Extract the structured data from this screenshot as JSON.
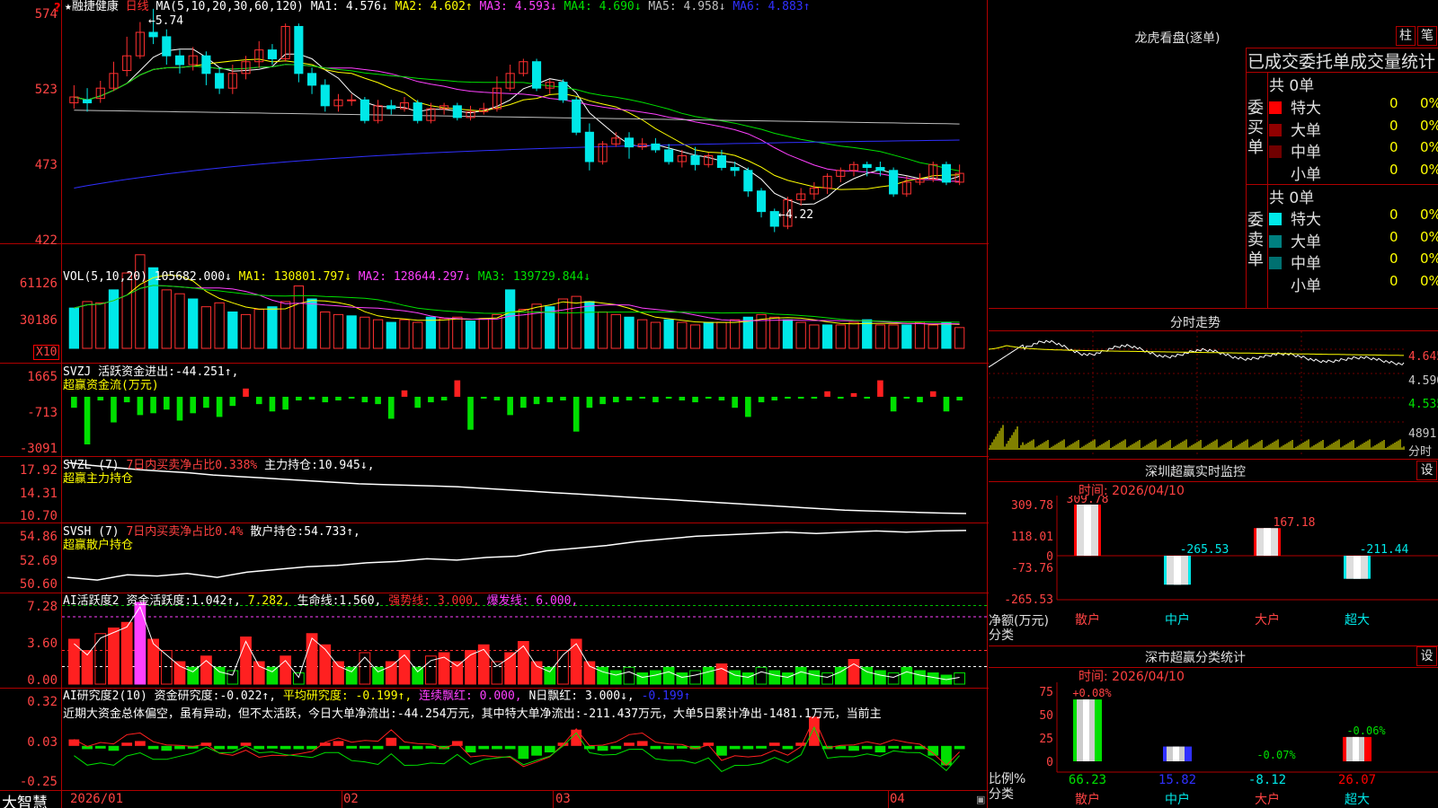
{
  "chart_title": {
    "star": "★",
    "stock": "融捷健康",
    "period": "日线"
  },
  "main": {
    "ma_label": "MA(5,10,20,30,60,120)",
    "ma": [
      {
        "name": "MA1:",
        "value": "4.576↓",
        "color": "#ffffff"
      },
      {
        "name": "MA2:",
        "value": "4.602↑",
        "color": "#ffff00"
      },
      {
        "name": "MA3:",
        "value": "4.593↓",
        "color": "#ff40ff"
      },
      {
        "name": "MA4:",
        "value": "4.690↓",
        "color": "#00e000"
      },
      {
        "name": "MA5:",
        "value": "4.958↓",
        "color": "#c0c0c0"
      },
      {
        "name": "MA6:",
        "value": "4.883↑",
        "color": "#3030ff"
      }
    ],
    "yaxis": [
      "574",
      "523",
      "473",
      "422"
    ],
    "high_note": "5.74",
    "low_note": "4.22"
  },
  "vol": {
    "label": "VOL(5,10,20)",
    "value": "105682.000↓",
    "ma": [
      {
        "name": "MA1:",
        "value": "130801.797↓",
        "color": "#ffff00"
      },
      {
        "name": "MA2:",
        "value": "128644.297↓",
        "color": "#ff40ff"
      },
      {
        "name": "MA3:",
        "value": "139729.844↓",
        "color": "#00e000"
      }
    ],
    "yaxis": [
      "61126",
      "30186"
    ],
    "unit": "X10"
  },
  "svzj": {
    "label": "SVZJ",
    "name": "活跃资金进出:",
    "value": "-44.251↑,",
    "sub": "超赢资金流(万元)",
    "yaxis": [
      "1665",
      "-713",
      "-3091"
    ]
  },
  "svzl": {
    "label": "SVZL (7)",
    "ratio": "7日内买卖净占比0.338%",
    "name": "主力持仓:",
    "value": "10.945↓,",
    "sub": "超赢主力持仓",
    "yaxis": [
      "17.92",
      "14.31",
      "10.70"
    ]
  },
  "svsh": {
    "label": "SVSH (7)",
    "ratio": "7日内买卖净占比0.4%",
    "name": "散户持仓:",
    "value": "54.733↑,",
    "sub": "超赢散户持仓",
    "yaxis": [
      "54.86",
      "52.69",
      "50.60"
    ]
  },
  "ai_active": {
    "label": "AI活跃度2",
    "name": "资金活跃度:",
    "value": "1.042↑,",
    "v2": "7.282,",
    "life_name": "生命线:",
    "life": "1.560,",
    "strong": "强势线: 3.000,",
    "burst": "爆发线: 6.000,",
    "yaxis": [
      "7.28",
      "3.60",
      "0.00"
    ]
  },
  "ai_research": {
    "label": "AI研究度2(10)",
    "name": "资金研究度:",
    "value": "-0.022↑,",
    "avg": "平均研究度: -0.199↑,",
    "red_n": "连续飘红: 0.000,",
    "n_red": "N日飘红: 3.000↓,",
    "last": "-0.199↑",
    "comment": "近期大资金总体偏空，虽有异动，但不太活跃，今日大单净流出:-44.254万元，其中特大单净流出:-211.437万元，大单5日累计净出-1481.1万元，当前主",
    "yaxis": [
      "0.32",
      "0.03",
      "-0.25"
    ]
  },
  "xaxis": [
    "2026/01",
    "02",
    "03",
    "04"
  ],
  "footer": {
    "brand": "大智慧"
  },
  "dragon": {
    "title": "龙虎看盘(逐单)",
    "btn_bar": "柱",
    "btn_pen": "笔",
    "header": "已成交委托单成交量统计",
    "buy_label": "委买单",
    "sell_label": "委卖单",
    "buy_total": "共 0单",
    "sell_total": "共 0单",
    "buy_rows": [
      {
        "name": "特大",
        "count": "0",
        "pct": "0%",
        "color": "#ff0000"
      },
      {
        "name": "大单",
        "count": "0",
        "pct": "0%",
        "color": "#900000"
      },
      {
        "name": "中单",
        "count": "0",
        "pct": "0%",
        "color": "#700000"
      },
      {
        "name": "小单",
        "count": "0",
        "pct": "0%",
        "color": "#000000"
      }
    ],
    "sell_rows": [
      {
        "name": "特大",
        "count": "0",
        "pct": "0%",
        "color": "#00e8e8"
      },
      {
        "name": "大单",
        "count": "0",
        "pct": "0%",
        "color": "#008080"
      },
      {
        "name": "中单",
        "count": "0",
        "pct": "0%",
        "color": "#007070"
      },
      {
        "name": "小单",
        "count": "0",
        "pct": "0%",
        "color": "#000000"
      }
    ]
  },
  "intraday": {
    "title": "分时走势",
    "prices": [
      "4.645",
      "4.590",
      "4.535"
    ],
    "vol": "4891",
    "vol_unit": "分时"
  },
  "monitor": {
    "title": "深圳超赢实时监控",
    "btn": "设",
    "date": "时间: 2026/04/10",
    "yaxis": [
      "309.78",
      "118.01",
      "0",
      "-73.76",
      "-265.53"
    ],
    "ylabel": "净额(万元)",
    "xlabel": "分类",
    "categories": [
      "散户",
      "中户",
      "大户",
      "超大"
    ],
    "bar_labels": [
      "309.78",
      "-265.53",
      "167.18",
      "-211.44"
    ]
  },
  "classify": {
    "title": "深市超赢分类统计",
    "btn": "设",
    "date": "时间: 2026/04/10",
    "yaxis": [
      "75",
      "50",
      "25",
      "0"
    ],
    "ylabel": "比例%",
    "xlabel": "分类",
    "categories": [
      "散户",
      "中户",
      "大户",
      "超大"
    ],
    "top_labels": [
      "+0.08%",
      "",
      "-0.07%",
      "-0.06%"
    ],
    "bottom_values": [
      "66.23",
      "15.82",
      "-8.12",
      "26.07"
    ]
  },
  "chart_data": [
    {
      "type": "candlestick",
      "title": "融捷健康 日线",
      "ylim": [
        4.15,
        5.8
      ],
      "x": [
        "2026/01",
        "02",
        "03",
        "04"
      ],
      "ohlc": [
        [
          5.1,
          5.14,
          5.22,
          5.06
        ],
        [
          5.12,
          5.1,
          5.2,
          5.04
        ],
        [
          5.13,
          5.2,
          5.25,
          5.1
        ],
        [
          5.2,
          5.3,
          5.38,
          5.18
        ],
        [
          5.32,
          5.42,
          5.55,
          5.28
        ],
        [
          5.42,
          5.58,
          5.65,
          5.4
        ],
        [
          5.58,
          5.55,
          5.74,
          5.5
        ],
        [
          5.55,
          5.42,
          5.6,
          5.36
        ],
        [
          5.42,
          5.36,
          5.46,
          5.3
        ],
        [
          5.36,
          5.42,
          5.48,
          5.32
        ],
        [
          5.42,
          5.3,
          5.45,
          5.22
        ],
        [
          5.3,
          5.2,
          5.34,
          5.16
        ],
        [
          5.2,
          5.3,
          5.36,
          5.16
        ],
        [
          5.3,
          5.38,
          5.42,
          5.26
        ],
        [
          5.38,
          5.46,
          5.52,
          5.34
        ],
        [
          5.46,
          5.4,
          5.5,
          5.36
        ],
        [
          5.4,
          5.62,
          5.64,
          5.38
        ],
        [
          5.62,
          5.3,
          5.64,
          5.24
        ],
        [
          5.3,
          5.22,
          5.34,
          5.16
        ],
        [
          5.22,
          5.08,
          5.26,
          5.04
        ],
        [
          5.08,
          5.12,
          5.16,
          5.04
        ],
        [
          5.12,
          5.12,
          5.16,
          5.08
        ],
        [
          5.12,
          4.98,
          5.14,
          4.96
        ],
        [
          4.98,
          5.08,
          5.12,
          4.96
        ],
        [
          5.08,
          5.06,
          5.12,
          5.02
        ],
        [
          5.06,
          5.1,
          5.14,
          5.04
        ],
        [
          5.1,
          4.98,
          5.12,
          4.96
        ],
        [
          4.98,
          5.06,
          5.1,
          4.96
        ],
        [
          5.06,
          5.08,
          5.1,
          5.02
        ],
        [
          5.08,
          5.0,
          5.1,
          4.98
        ],
        [
          5.0,
          5.04,
          5.08,
          4.98
        ],
        [
          5.04,
          5.06,
          5.1,
          5.02
        ],
        [
          5.06,
          5.2,
          5.28,
          5.04
        ],
        [
          5.2,
          5.3,
          5.36,
          5.18
        ],
        [
          5.3,
          5.38,
          5.4,
          5.28
        ],
        [
          5.38,
          5.2,
          5.4,
          5.18
        ],
        [
          5.2,
          5.24,
          5.26,
          5.16
        ],
        [
          5.24,
          5.12,
          5.26,
          5.1
        ],
        [
          5.12,
          4.9,
          5.14,
          4.88
        ],
        [
          4.9,
          4.7,
          4.96,
          4.64
        ],
        [
          4.7,
          4.82,
          4.84,
          4.68
        ],
        [
          4.82,
          4.86,
          4.9,
          4.8
        ],
        [
          4.86,
          4.8,
          4.9,
          4.72
        ],
        [
          4.8,
          4.82,
          4.86,
          4.78
        ],
        [
          4.82,
          4.78,
          4.86,
          4.76
        ],
        [
          4.78,
          4.7,
          4.82,
          4.68
        ],
        [
          4.7,
          4.74,
          4.78,
          4.66
        ],
        [
          4.74,
          4.68,
          4.8,
          4.64
        ],
        [
          4.68,
          4.74,
          4.76,
          4.66
        ],
        [
          4.74,
          4.66,
          4.78,
          4.64
        ],
        [
          4.66,
          4.64,
          4.7,
          4.6
        ],
        [
          4.64,
          4.5,
          4.66,
          4.46
        ],
        [
          4.5,
          4.36,
          4.52,
          4.32
        ],
        [
          4.36,
          4.26,
          4.38,
          4.22
        ],
        [
          4.26,
          4.44,
          4.46,
          4.24
        ],
        [
          4.44,
          4.48,
          4.52,
          4.4
        ],
        [
          4.48,
          4.52,
          4.56,
          4.44
        ],
        [
          4.52,
          4.6,
          4.62,
          4.48
        ],
        [
          4.6,
          4.64,
          4.66,
          4.56
        ],
        [
          4.64,
          4.68,
          4.7,
          4.6
        ],
        [
          4.68,
          4.66,
          4.7,
          4.6
        ],
        [
          4.66,
          4.64,
          4.7,
          4.6
        ],
        [
          4.64,
          4.48,
          4.66,
          4.46
        ],
        [
          4.48,
          4.56,
          4.6,
          4.46
        ],
        [
          4.56,
          4.58,
          4.62,
          4.54
        ],
        [
          4.58,
          4.68,
          4.7,
          4.56
        ],
        [
          4.68,
          4.56,
          4.7,
          4.54
        ],
        [
          4.56,
          4.62,
          4.68,
          4.54
        ]
      ]
    },
    {
      "type": "bar",
      "title": "VOL",
      "ylim": [
        0,
        61126
      ],
      "values": [
        3.1,
        3.6,
        3.5,
        4.5,
        5.8,
        7.2,
        6.2,
        4.5,
        4.2,
        3.8,
        3.2,
        3.5,
        2.8,
        2.6,
        3.0,
        3.2,
        3.6,
        4.8,
        3.8,
        2.8,
        2.6,
        2.5,
        2.4,
        2.2,
        2.0,
        2.2,
        2.0,
        2.4,
        2.3,
        2.4,
        2.1,
        2.3,
        2.6,
        4.5,
        3.0,
        3.4,
        3.2,
        3.8,
        4.0,
        3.6,
        2.8,
        2.6,
        2.4,
        2.2,
        2.0,
        2.2,
        2.0,
        1.8,
        2.0,
        2.0,
        2.2,
        2.4,
        2.6,
        2.4,
        2.2,
        2.0,
        1.8,
        1.8,
        1.8,
        2.0,
        2.2,
        1.8,
        1.8,
        1.8,
        2.0,
        1.8,
        2.0,
        1.6
      ]
    },
    {
      "type": "bar",
      "title": "SVZJ",
      "ylim": [
        -3091,
        1665
      ],
      "values": [
        -600,
        -2600,
        -200,
        -1400,
        -300,
        -1000,
        -900,
        -700,
        -1300,
        -900,
        -600,
        -1100,
        -500,
        450,
        -400,
        -800,
        -700,
        -200,
        -150,
        -300,
        -200,
        -100,
        -300,
        -400,
        -1200,
        350,
        -600,
        -300,
        -200,
        900,
        -1800,
        -100,
        -200,
        -1000,
        -600,
        -400,
        -300,
        -200,
        -1900,
        -600,
        -400,
        -300,
        -200,
        -100,
        -300,
        -100,
        -200,
        -300,
        -100,
        -200,
        -600,
        -1100,
        -300,
        -200,
        -100,
        -100,
        -100,
        300,
        -100,
        200,
        -100,
        900,
        -800,
        -100,
        -300,
        300,
        -800,
        -200
      ]
    },
    {
      "type": "line",
      "title": "SVZL",
      "ylim": [
        10.7,
        17.92
      ],
      "values": [
        17.9,
        17.5,
        17.2,
        16.9,
        16.7,
        16.5,
        16.2,
        16.0,
        15.8,
        15.6,
        15.4,
        15.2,
        15.0,
        14.9,
        14.8,
        14.7,
        14.6,
        14.4,
        14.2,
        14.0,
        13.8,
        13.6,
        13.4,
        13.2,
        13.0,
        12.8,
        12.6,
        12.4,
        12.2,
        12.0,
        11.8,
        11.6,
        11.4,
        11.3,
        11.2,
        11.1,
        11.0,
        10.95
      ]
    },
    {
      "type": "line",
      "title": "SVSH",
      "ylim": [
        50.6,
        54.86
      ],
      "values": [
        51.2,
        51.0,
        51.4,
        51.3,
        51.5,
        51.2,
        51.6,
        51.8,
        52.0,
        52.1,
        52.3,
        52.4,
        52.6,
        52.5,
        52.7,
        52.8,
        53.2,
        53.4,
        53.6,
        53.9,
        54.1,
        54.3,
        54.4,
        54.5,
        54.6,
        54.5,
        54.6,
        54.7,
        54.6,
        54.7,
        54.73
      ]
    },
    {
      "type": "bar",
      "title": "AI活跃度2",
      "ylim": [
        0,
        7.28
      ],
      "values": [
        4.0,
        3.0,
        4.5,
        5.0,
        5.5,
        7.28,
        4.0,
        3.0,
        2.0,
        1.5,
        2.5,
        1.5,
        1.2,
        4.2,
        2.0,
        1.5,
        2.5,
        1.0,
        4.5,
        3.5,
        2.0,
        1.5,
        2.8,
        1.5,
        2.0,
        3.0,
        1.5,
        2.5,
        2.8,
        2.0,
        3.0,
        3.5,
        2.0,
        2.8,
        3.8,
        2.0,
        1.5,
        3.0,
        4.0,
        2.0,
        1.5,
        1.2,
        1.5,
        1.0,
        1.2,
        1.5,
        1.0,
        1.2,
        1.5,
        1.8,
        1.2,
        1.0,
        1.5,
        1.2,
        1.0,
        1.5,
        1.2,
        1.0,
        1.5,
        2.2,
        1.5,
        1.2,
        1.0,
        1.5,
        1.2,
        1.0,
        0.8,
        1.0
      ]
    },
    {
      "type": "bar",
      "title": "AI研究度2",
      "ylim": [
        -0.25,
        0.32
      ],
      "values": [
        0.04,
        -0.02,
        -0.01,
        -0.03,
        0.02,
        0.03,
        -0.02,
        -0.03,
        -0.02,
        -0.01,
        0.02,
        -0.02,
        -0.02,
        0.02,
        -0.02,
        -0.01,
        -0.02,
        -0.02,
        -0.02,
        0.02,
        0.03,
        -0.01,
        -0.01,
        -0.02,
        0.05,
        -0.02,
        -0.02,
        -0.01,
        -0.02,
        0.03,
        -0.04,
        -0.02,
        -0.02,
        -0.02,
        -0.08,
        -0.06,
        -0.04,
        0.02,
        0.1,
        -0.02,
        -0.03,
        -0.02,
        0.02,
        0.03,
        -0.02,
        -0.02,
        -0.01,
        -0.02,
        0.02,
        -0.06,
        -0.02,
        -0.02,
        -0.01,
        0.02,
        -0.02,
        0.02,
        0.18,
        -0.02,
        -0.02,
        -0.03,
        -0.02,
        -0.04,
        -0.01,
        -0.02,
        -0.02,
        -0.06,
        -0.12,
        -0.02
      ]
    }
  ]
}
